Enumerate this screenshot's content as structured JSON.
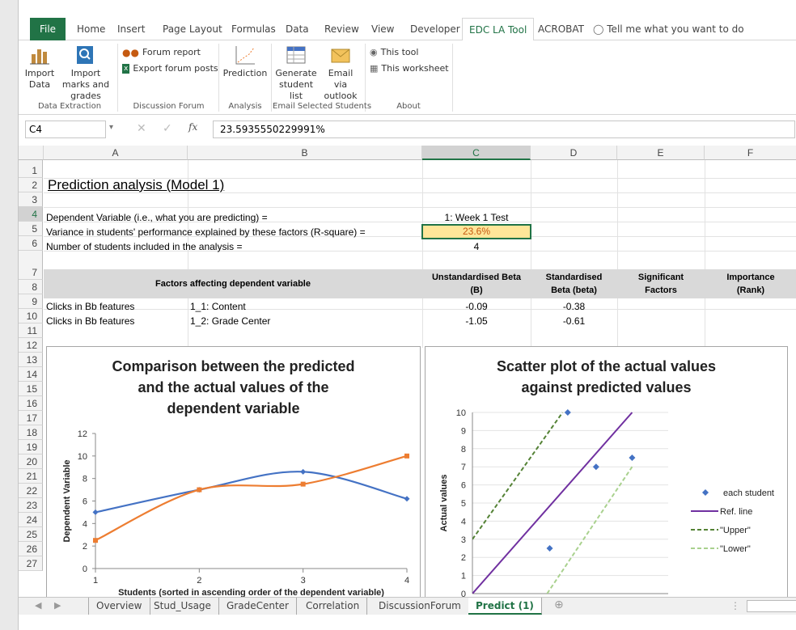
{
  "ribbon_tabs": [
    "File",
    "Home",
    "Insert",
    "Page Layout",
    "Formulas",
    "Data",
    "Review",
    "View",
    "Developer",
    "EDC LA Tool",
    "ACROBAT"
  ],
  "tell_me": "Tell me what you want to do",
  "ribbon": {
    "import_data": "Import Data",
    "import_marks": "Import marks and grades",
    "forum_report": "Forum report",
    "export_forum": "Export forum posts",
    "prediction": "Prediction",
    "generate_list": "Generate student list",
    "email_outlook": "Email via outlook",
    "this_tool": "This tool",
    "this_worksheet": "This worksheet",
    "groups": {
      "data_extraction": "Data Extraction",
      "discussion_forum": "Discussion Forum",
      "analysis": "Analysis",
      "email_selected": "Email Selected Students",
      "about": "About"
    }
  },
  "name_box": "C4",
  "formula_value": "23.5935550229991%",
  "columns": [
    "A",
    "B",
    "C",
    "D",
    "E",
    "F"
  ],
  "rows": [
    "1",
    "2",
    "3",
    "4",
    "5",
    "6",
    "7",
    "8",
    "9",
    "10",
    "11",
    "12",
    "13",
    "14",
    "15",
    "16",
    "17",
    "18",
    "19",
    "20",
    "21",
    "22",
    "23",
    "24",
    "25",
    "26",
    "27"
  ],
  "cells": {
    "title": "Prediction analysis (Model 1)",
    "a3": "Dependent Variable (i.e., what you are predicting) =",
    "c3": "1: Week 1 Test",
    "a4": "Variance in students' performance explained by these factors (R-square) =",
    "c4": "23.6%",
    "a5": "Number of students included in the analysis =",
    "c5": "4",
    "h_factors": "Factors affecting dependent variable",
    "h_unstd_1": "Unstandardised Beta",
    "h_unstd_2": "(B)",
    "h_std_1": "Standardised",
    "h_std_2": "Beta (beta)",
    "h_sig_1": "Significant",
    "h_sig_2": "Factors",
    "h_imp_1": "Importance",
    "h_imp_2": "(Rank)",
    "a8": "Clicks in Bb features",
    "b8": "1_1: Content",
    "c8": "-0.09",
    "d8": "-0.38",
    "a9": "Clicks in Bb features",
    "b9": "1_2: Grade Center",
    "c9": "-1.05",
    "d9": "-0.61"
  },
  "chart_data": [
    {
      "type": "line",
      "title": "Comparison between the predicted and the actual values of the dependent variable",
      "title_lines": [
        "Comparison between the predicted",
        "and the actual values of the",
        "dependent variable"
      ],
      "xlabel": "Students (sorted in ascending order of the dependent variable)",
      "ylabel": "Dependent Variable",
      "xlim": [
        1,
        4
      ],
      "ylim": [
        0,
        12
      ],
      "x_ticks": [
        "1",
        "2",
        "3",
        "4"
      ],
      "y_ticks": [
        "0",
        "2",
        "4",
        "6",
        "8",
        "10",
        "12"
      ],
      "x": [
        1,
        2,
        3,
        4
      ],
      "series": [
        {
          "values": [
            5,
            7,
            8.6,
            6.2
          ],
          "color": "#4472c4"
        },
        {
          "values": [
            2.5,
            7,
            7.5,
            10
          ],
          "color": "#ed7d31"
        }
      ]
    },
    {
      "type": "scatter",
      "title": "Scatter plot of the actual values against predicted values",
      "title_lines": [
        "Scatter plot of the actual values",
        "against predicted values"
      ],
      "ylabel": "Actual values",
      "xlim": [
        5.5,
        9.3
      ],
      "ylim": [
        0,
        10
      ],
      "y_ticks": [
        "0",
        "1",
        "2",
        "3",
        "4",
        "5",
        "6",
        "7",
        "8",
        "9",
        "10"
      ],
      "legend": [
        {
          "name": "each student",
          "color": "#4472c4",
          "style": "marker"
        },
        {
          "name": "Ref. line",
          "color": "#7030a0",
          "style": "solid"
        },
        {
          "name": "\"Upper\"",
          "color": "#548235",
          "style": "dash"
        },
        {
          "name": "\"Lower\"",
          "color": "#a9d18e",
          "style": "dash"
        }
      ],
      "points": [
        {
          "x": 7.35,
          "y": 10
        },
        {
          "x": 7.9,
          "y": 7
        },
        {
          "x": 8.6,
          "y": 7.5
        },
        {
          "x": 7.0,
          "y": 2.5
        }
      ],
      "lines": [
        {
          "name": "Ref. line",
          "from": [
            5.5,
            0
          ],
          "to": [
            8.6,
            10
          ],
          "color": "#7030a0",
          "dash": false
        },
        {
          "name": "Upper",
          "from": [
            5.5,
            3
          ],
          "to": [
            7.25,
            10
          ],
          "color": "#548235",
          "dash": true
        },
        {
          "name": "Lower",
          "from": [
            6.95,
            0
          ],
          "to": [
            8.6,
            7
          ],
          "color": "#a9d18e",
          "dash": true
        }
      ]
    }
  ],
  "sheet_tabs": [
    "Overview",
    "Stud_Usage",
    "GradeCenter",
    "Correlation",
    "DiscussionForum",
    "Predict (1)"
  ]
}
